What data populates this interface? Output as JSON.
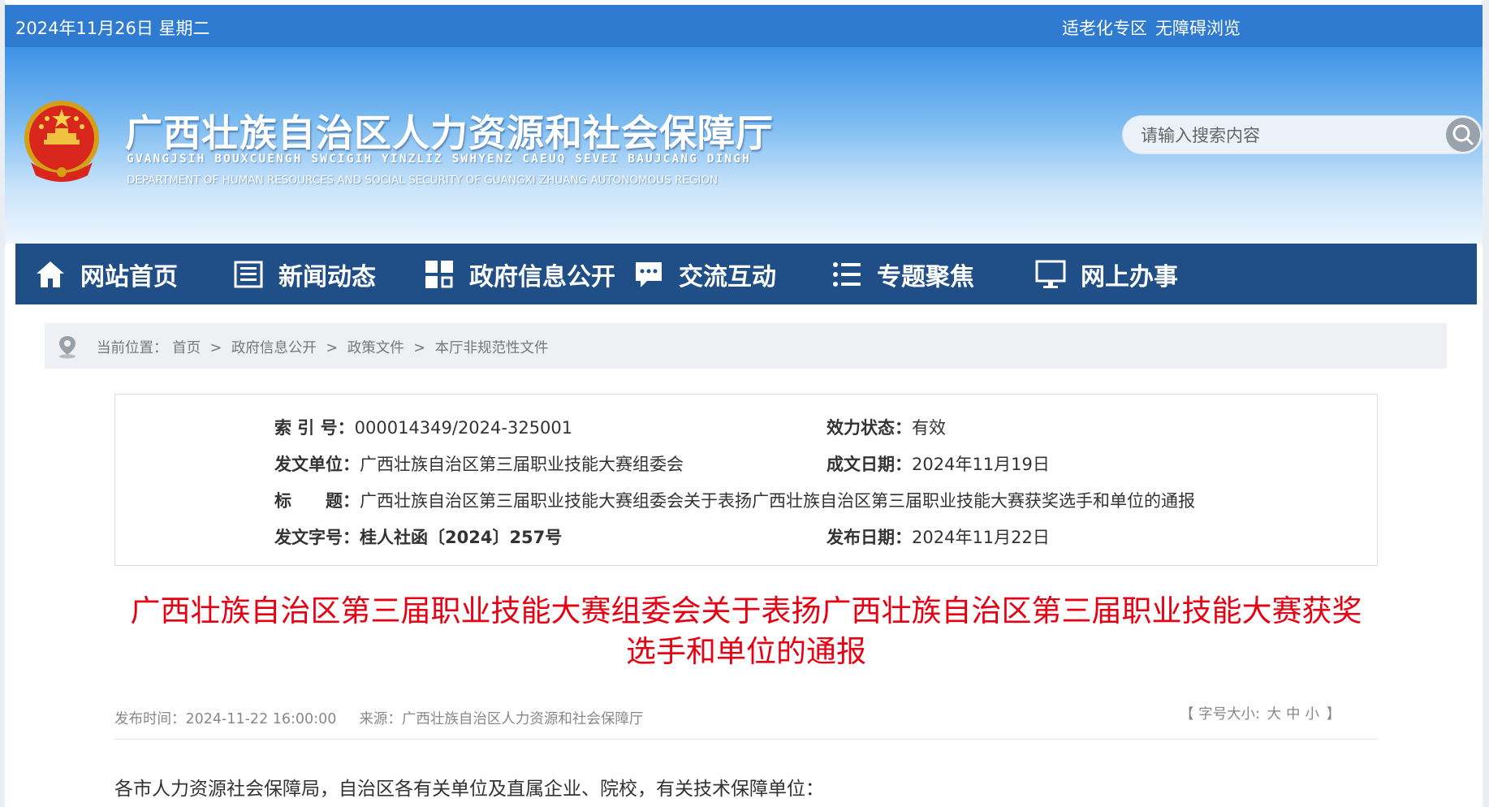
{
  "topbar": {
    "date": "2024年11月26日 星期二",
    "links": [
      "适老化专区",
      "无障碍浏览"
    ]
  },
  "header": {
    "title": "广西壮族自治区人力资源和社会保障厅",
    "title_zhuang": "GVANGJSIH BOUXCUENGH SWCIGIH YINZLIZ SWHYENZ CAEUQ SEVEI BAUJCANG DINGH",
    "title_en": "DEPARTMENT OF HUMAN RESOURCES AND SOCIAL SECURITY OF GUANGXI ZHUANG AUTONOMOUS REGION"
  },
  "search": {
    "placeholder": "请输入搜索内容"
  },
  "nav": {
    "items": [
      {
        "label": "网站首页",
        "icon": "home-icon"
      },
      {
        "label": "新闻动态",
        "icon": "news-icon"
      },
      {
        "label": "政府信息公开",
        "icon": "grid-icon"
      },
      {
        "label": "交流互动",
        "icon": "chat-icon"
      },
      {
        "label": "专题聚焦",
        "icon": "list-icon"
      },
      {
        "label": "网上办事",
        "icon": "monitor-icon"
      }
    ]
  },
  "breadcrumb": {
    "prefix": "当前位置：",
    "items": [
      "首页",
      "政府信息公开",
      "政策文件",
      "本厅非规范性文件"
    ],
    "separator": ">"
  },
  "meta": {
    "index_label": "索 引 号：",
    "index_value": "000014349/2024-325001",
    "status_label": "效力状态：",
    "status_value": "有效",
    "issuer_label": "发文单位：",
    "issuer_value": "广西壮族自治区第三届职业技能大赛组委会",
    "date_label": "成文日期：",
    "date_value": "2024年11月19日",
    "title_label": "标　　题：",
    "title_value": "广西壮族自治区第三届职业技能大赛组委会关于表扬广西壮族自治区第三届职业技能大赛获奖选手和单位的通报",
    "docno_label": "发文字号：",
    "docno_value": "桂人社函〔2024〕257号",
    "pubdate_label": "发布日期：",
    "pubdate_value": "2024年11月22日"
  },
  "article": {
    "title_line1": "广西壮族自治区第三届职业技能大赛组委会关于表扬广西壮族自治区第三届职业技能大赛获奖",
    "title_line2": "选手和单位的通报",
    "publish_time": "发布时间：2024-11-22 16:00:00",
    "source": "来源：广西壮族自治区人力资源和社会保障厅",
    "font_size_label": "【 字号大小:",
    "font_sizes": [
      "大",
      "中",
      "小"
    ],
    "font_size_close": "】",
    "body_first_line": "各市人力资源社会保障局，自治区各有关单位及直属企业、院校，有关技术保障单位："
  },
  "colors": {
    "topbar": "#2e7bd1",
    "nav": "#1f4f86",
    "title_red": "#e60012"
  }
}
